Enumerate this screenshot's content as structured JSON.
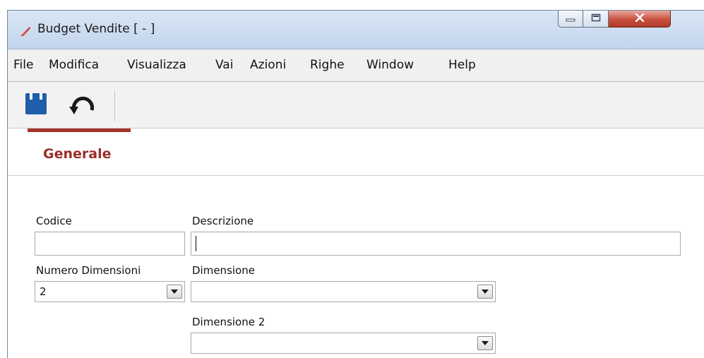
{
  "window": {
    "title": "Budget Vendite [ - ]",
    "icon": "app-logo-icon",
    "controls": [
      "minimize-icon",
      "maximize-icon",
      "close-icon"
    ]
  },
  "menu": {
    "items": [
      "File",
      "Modifica",
      "Visualizza",
      "Vai",
      "Azioni",
      "Righe",
      "Window",
      "Help"
    ]
  },
  "toolbar": {
    "buttons": [
      "save-icon",
      "undo-icon"
    ]
  },
  "tabs": [
    {
      "label": "Generale",
      "active": true
    }
  ],
  "form": {
    "codice": {
      "label": "Codice",
      "value": ""
    },
    "descrizione": {
      "label": "Descrizione",
      "value": ""
    },
    "numero_dimensioni": {
      "label": "Numero Dimensioni",
      "value": "2"
    },
    "dimensione": {
      "label": "Dimensione",
      "value": ""
    },
    "dimensione2": {
      "label": "Dimensione 2",
      "value": ""
    }
  },
  "colors": {
    "accent": "#a5322b",
    "titlebar": "#cfdef1",
    "close_button": "#c7503e"
  }
}
